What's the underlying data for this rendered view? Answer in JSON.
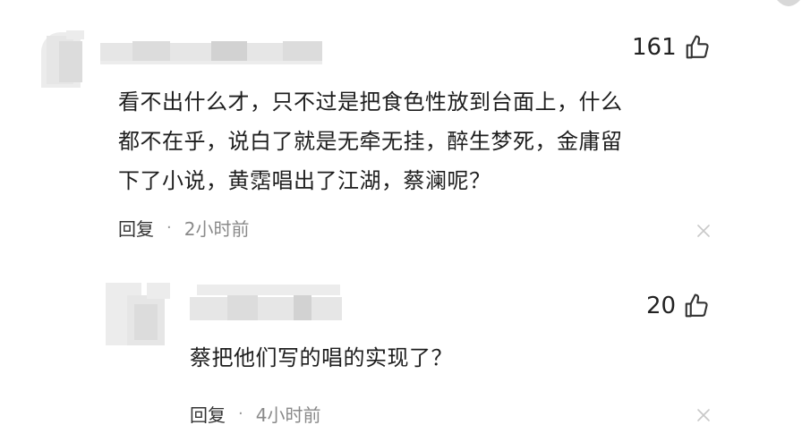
{
  "comments": [
    {
      "likes": "161",
      "text_lines": [
        "看不出什么才，只不过是把食色性放到台面上，什么",
        "都不在乎，说白了就是无牵无挂，醉生梦死，金庸留",
        "下了小说，黄霑唱出了江湖，蔡澜呢？"
      ],
      "reply_label": "回复",
      "separator": "·",
      "time": "2小时前"
    },
    {
      "likes": "20",
      "text_lines": [
        "蔡把他们写的唱的实现了？"
      ],
      "reply_label": "回复",
      "separator": "·",
      "time": "4小时前"
    }
  ],
  "icons": {
    "like": "thumbs-up-icon",
    "close": "close-icon"
  },
  "colors": {
    "text": "#1e1e1e",
    "meta": "#8a8a8a",
    "icon": "#333333",
    "close": "#c8c8c8"
  }
}
